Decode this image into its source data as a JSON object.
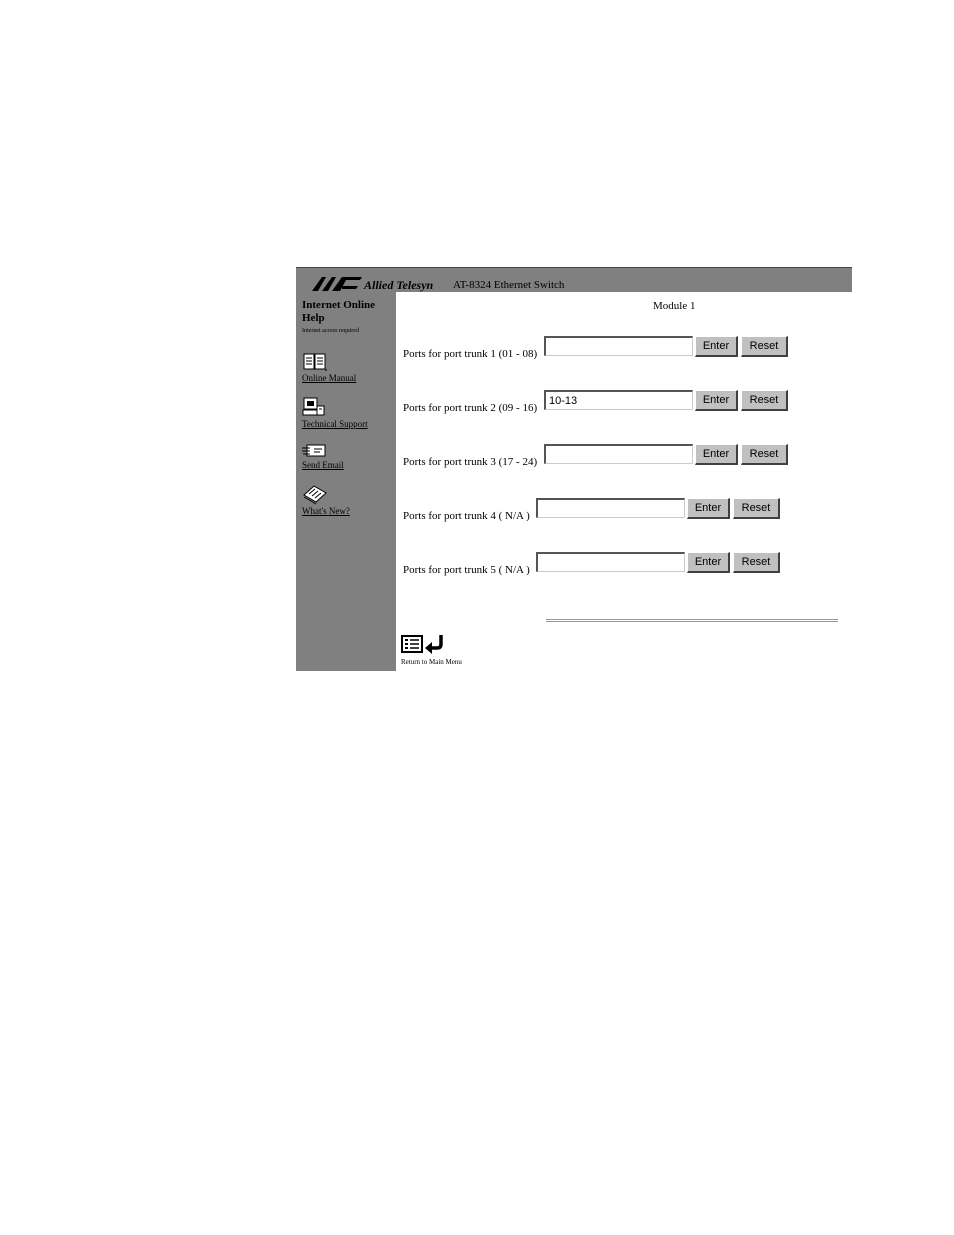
{
  "header": {
    "brand": "Allied Telesyn",
    "product": "AT-8324  Ethernet Switch"
  },
  "sidebar": {
    "title": "Internet Online Help",
    "note": "Internet access required",
    "links": [
      {
        "label": "Online Manual",
        "icon": "book-icon"
      },
      {
        "label": "Technical Support",
        "icon": "support-icon"
      },
      {
        "label": "Send Email",
        "icon": "envelope-icon"
      },
      {
        "label": "What's New?",
        "icon": "news-icon"
      }
    ]
  },
  "main": {
    "module_title": "Module 1",
    "trunks": [
      {
        "label": "Ports for port trunk 1 (01 - 08)",
        "value": "",
        "enter": "Enter",
        "reset": "Reset"
      },
      {
        "label": "Ports for port trunk 2 (09 - 16)",
        "value": "10-13",
        "enter": "Enter",
        "reset": "Reset"
      },
      {
        "label": "Ports for port trunk 3 (17 - 24)",
        "value": "",
        "enter": "Enter",
        "reset": "Reset"
      },
      {
        "label": "Ports for port trunk 4 ( N/A )",
        "value": "",
        "enter": "Enter",
        "reset": "Reset"
      },
      {
        "label": "Ports for port trunk 5 ( N/A )",
        "value": "",
        "enter": "Enter",
        "reset": "Reset"
      }
    ],
    "return_label": "Return to Main Menu"
  }
}
